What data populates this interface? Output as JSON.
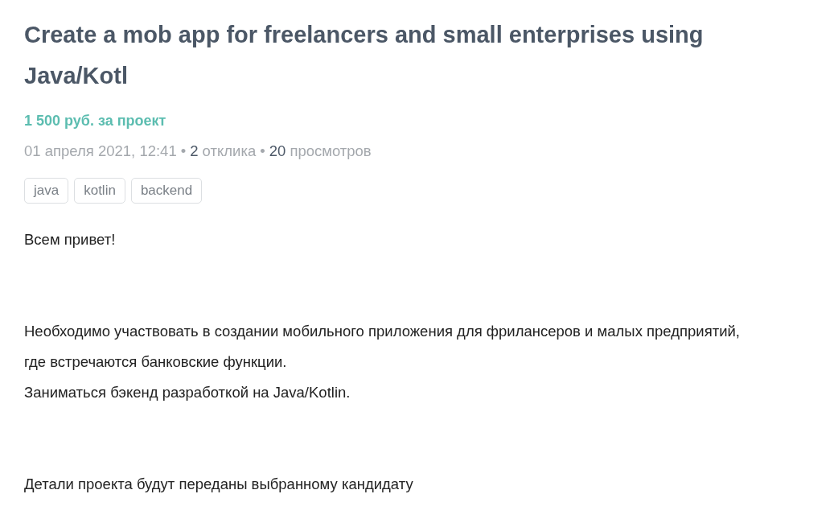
{
  "title": "Create a mob app for freelancers and small enterprises using Java/Kotl",
  "price": "1 500 руб. за проект",
  "meta": [
    {
      "kind": "date",
      "text": "01 апреля 2021, 12:41"
    },
    {
      "kind": "count",
      "separator": "•",
      "count": "2",
      "label": "отклика"
    },
    {
      "kind": "count",
      "separator": "•",
      "count": "20",
      "label": "просмотров"
    }
  ],
  "tags": [
    "java",
    "kotlin",
    "backend"
  ],
  "description": [
    [
      "Всем привет!"
    ],
    [
      "Необходимо участвовать в создании мобильного приложения для фрилансеров и малых предприятий, где встречаются банковские функции.",
      "Заниматься бэкенд разработкой на Java/Kotlin."
    ],
    [
      "Детали проекта будут переданы выбранному кандидату"
    ]
  ]
}
